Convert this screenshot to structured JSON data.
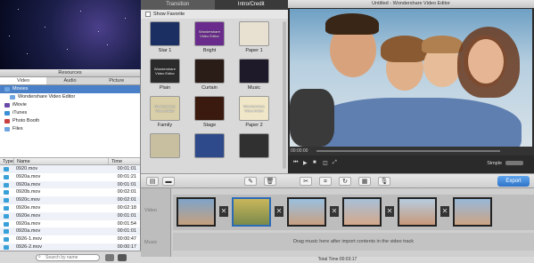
{
  "resources": {
    "title": "Resources",
    "tabs": [
      "Video",
      "Audio",
      "Picture"
    ],
    "tree": [
      "Movies",
      "Wondershare Video Editor",
      "iMovie",
      "iTunes",
      "Photo Booth",
      "Files"
    ],
    "columns": [
      "Type",
      "Name",
      "Time"
    ],
    "files": [
      {
        "name": "0920.mov",
        "time": "00:01:01"
      },
      {
        "name": "0920a.mov",
        "time": "00:01:21"
      },
      {
        "name": "0920a.mov",
        "time": "00:01:01"
      },
      {
        "name": "0920b.mov",
        "time": "00:02:01"
      },
      {
        "name": "0920c.mov",
        "time": "00:02:01"
      },
      {
        "name": "0920e.mov",
        "time": "00:02:18"
      },
      {
        "name": "0920e.mov",
        "time": "00:01:01"
      },
      {
        "name": "0920a.mov",
        "time": "00:01:54"
      },
      {
        "name": "0920a.mov",
        "time": "00:01:01"
      },
      {
        "name": "0926-1.mov",
        "time": "00:00:47"
      },
      {
        "name": "0926-2.mov",
        "time": "00:00:17"
      },
      {
        "name": "0926-3.mov",
        "time": "00:01:01"
      }
    ],
    "search_placeholder": "Search by name"
  },
  "effects": {
    "tabs": [
      "Transition",
      "Intro/Credit"
    ],
    "show_favorite": "Show Favorite",
    "items": [
      {
        "label": "Star 1",
        "color": "#1b2f63"
      },
      {
        "label": "Bright",
        "color": "#6a2c8c"
      },
      {
        "label": "Paper 1",
        "color": "#e8e0d0"
      },
      {
        "label": "Plain",
        "color": "#2b2b2b"
      },
      {
        "label": "Curtain",
        "color": "#2a1c16"
      },
      {
        "label": "Music",
        "color": "#1e1a2a"
      },
      {
        "label": "Family",
        "color": "#d9cfa8"
      },
      {
        "label": "Stage",
        "color": "#3a1a0e"
      },
      {
        "label": "Paper 2",
        "color": "#f0e7c8"
      },
      {
        "label": "",
        "color": "#c8bfa0"
      },
      {
        "label": "",
        "color": "#2e4a8a"
      },
      {
        "label": "",
        "color": "#303030"
      }
    ],
    "thumb_text": "Wondershare Video Editor"
  },
  "window": {
    "title": "Untitled - Wondershare Video Editor",
    "time": "00:00:00",
    "mode": "Simple"
  },
  "toolbar": {
    "export": "Export"
  },
  "timeline": {
    "video_label": "Video",
    "music_label": "Music",
    "music_hint": "Drag music here after import contents in the video track",
    "total_time": "Total Time:00:03:17"
  }
}
